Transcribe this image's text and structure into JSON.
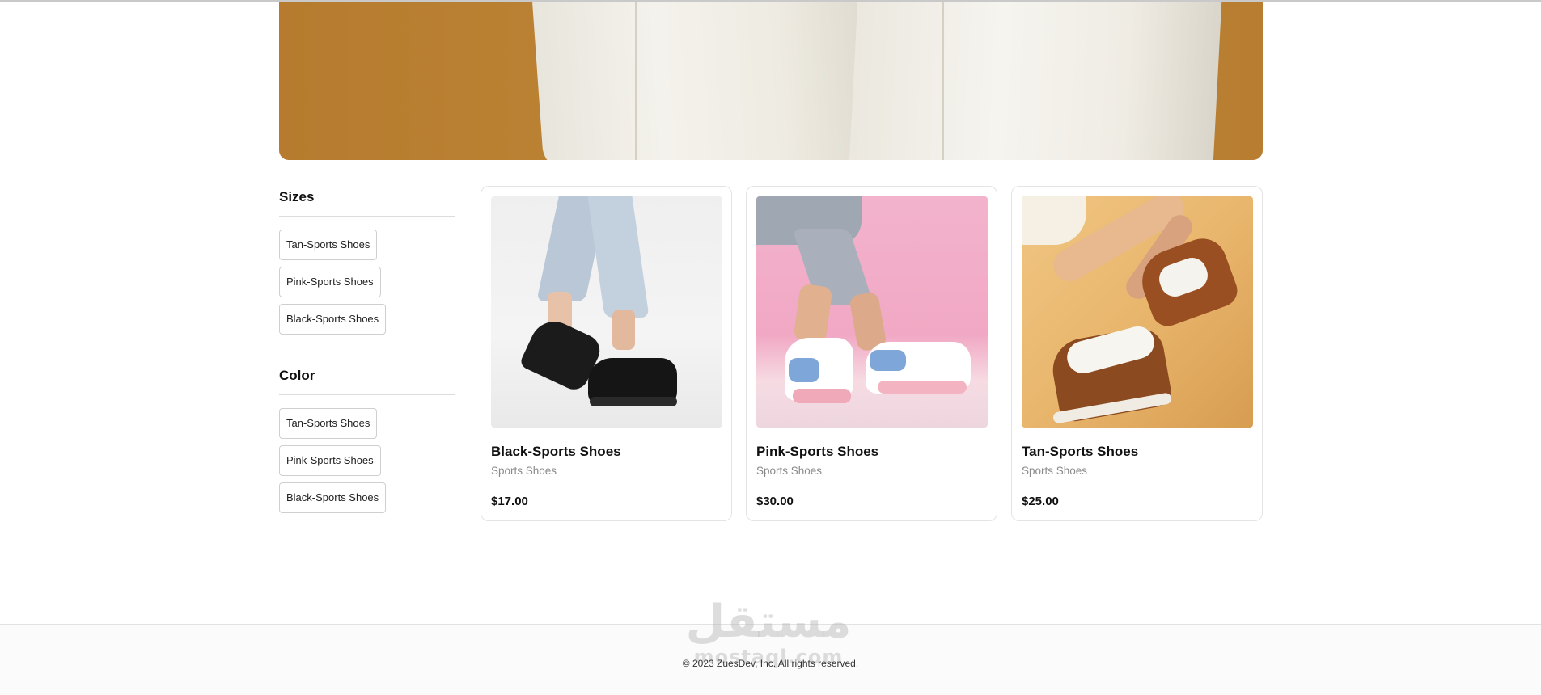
{
  "hero": {
    "image": "model-in-white-pants-on-orange-background"
  },
  "filters": [
    {
      "title": "Sizes",
      "options": [
        "Tan-Sports Shoes",
        "Pink-Sports Shoes",
        "Black-Sports Shoes"
      ]
    },
    {
      "title": "Color",
      "options": [
        "Tan-Sports Shoes",
        "Pink-Sports Shoes",
        "Black-Sports Shoes"
      ]
    }
  ],
  "products": [
    {
      "name": "Black-Sports Shoes",
      "category": "Sports Shoes",
      "price": "$17.00",
      "image": "black-sneakers-photo"
    },
    {
      "name": "Pink-Sports Shoes",
      "category": "Sports Shoes",
      "price": "$30.00",
      "image": "pink-blue-sneakers-photo"
    },
    {
      "name": "Tan-Sports Shoes",
      "category": "Sports Shoes",
      "price": "$25.00",
      "image": "tan-brown-sneakers-photo"
    }
  ],
  "footer": {
    "copyright": "© 2023 ZuesDev, Inc. All rights reserved.",
    "watermark_arabic": "مستقل",
    "watermark_latin": "mostaql.com"
  },
  "colors": {
    "hero_bg": "#b67b2e",
    "border": "#e4e4e4",
    "muted_text": "#8a8a8a"
  }
}
